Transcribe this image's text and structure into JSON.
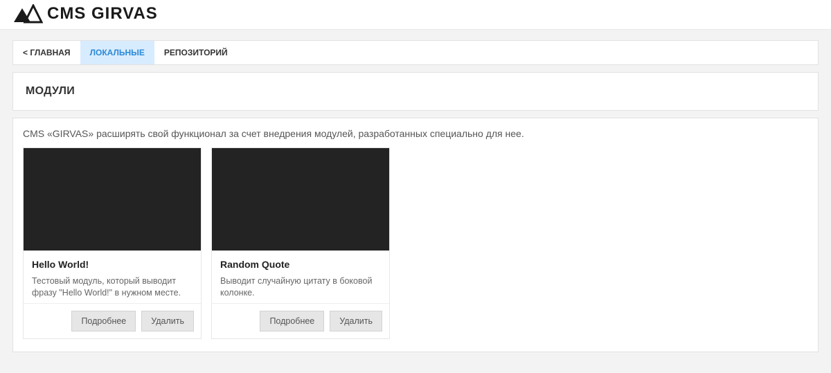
{
  "brand": {
    "name": "CMS GIRVAS"
  },
  "tabs": {
    "back": "< ГЛАВНАЯ",
    "local": "ЛОКАЛЬНЫЕ",
    "repo": "РЕПОЗИТОРИЙ"
  },
  "page": {
    "title": "МОДУЛИ"
  },
  "intro": "CMS «GIRVAS» расширять свой функционал за счет внедрения модулей, разработанных специально для нее.",
  "buttons": {
    "more": "Подробнее",
    "delete": "Удалить"
  },
  "modules": [
    {
      "title": "Hello World!",
      "desc": "Тестовый модуль, который выводит фразу \"Hello World!\" в нужном месте."
    },
    {
      "title": "Random Quote",
      "desc": "Выводит случайную цитату в боковой колонке."
    }
  ]
}
